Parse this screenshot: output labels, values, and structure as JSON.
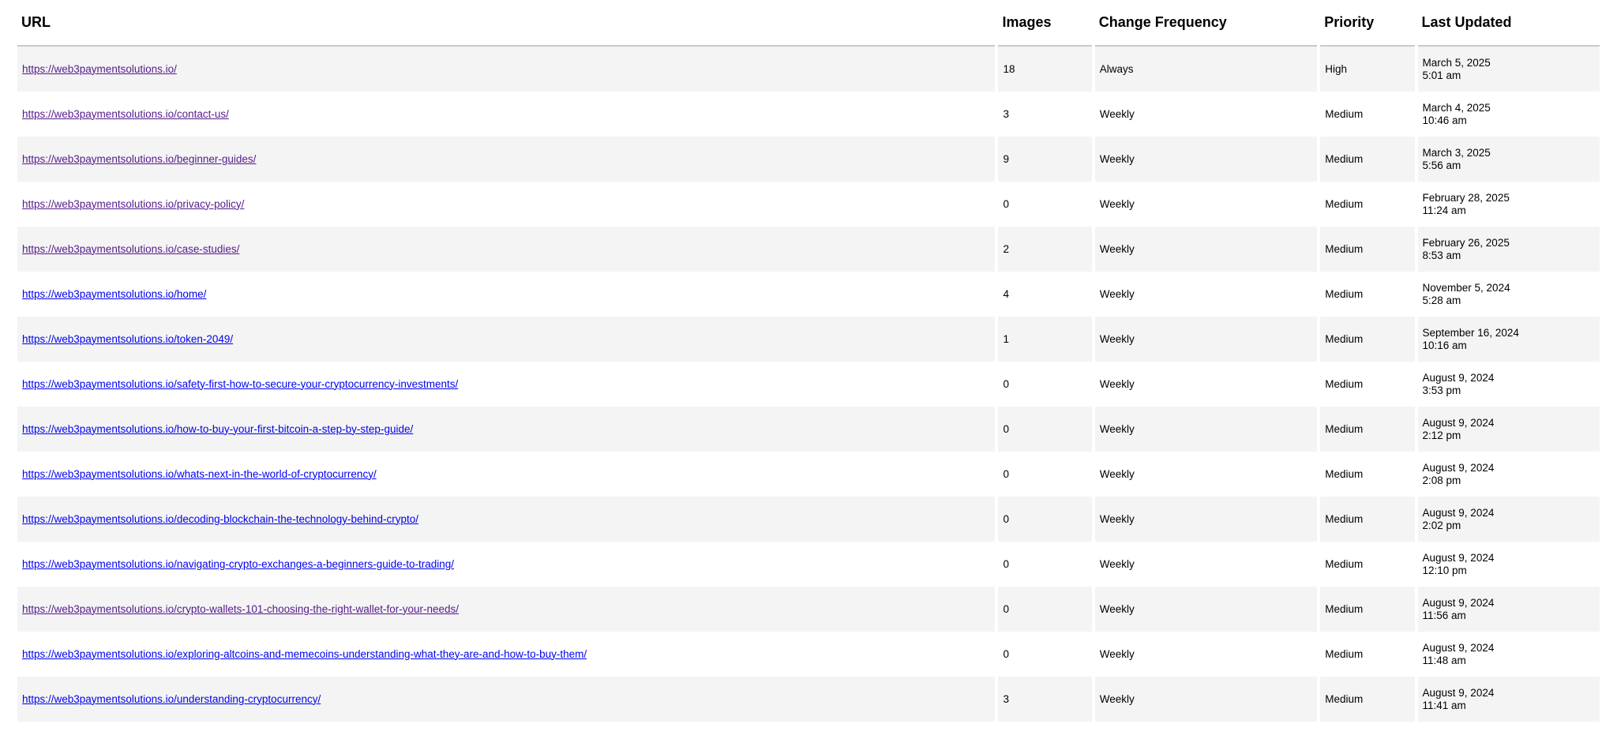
{
  "table": {
    "headers": {
      "url": "URL",
      "images": "Images",
      "frequency": "Change Frequency",
      "priority": "Priority",
      "updated": "Last Updated"
    },
    "rows": [
      {
        "url": "https://web3paymentsolutions.io/",
        "visited": true,
        "images": "18",
        "frequency": "Always",
        "priority": "High",
        "date": "March 5, 2025",
        "time": "5:01 am"
      },
      {
        "url": "https://web3paymentsolutions.io/contact-us/",
        "visited": true,
        "images": "3",
        "frequency": "Weekly",
        "priority": "Medium",
        "date": "March 4, 2025",
        "time": "10:46 am"
      },
      {
        "url": "https://web3paymentsolutions.io/beginner-guides/",
        "visited": true,
        "images": "9",
        "frequency": "Weekly",
        "priority": "Medium",
        "date": "March 3, 2025",
        "time": "5:56 am"
      },
      {
        "url": "https://web3paymentsolutions.io/privacy-policy/",
        "visited": true,
        "images": "0",
        "frequency": "Weekly",
        "priority": "Medium",
        "date": "February 28, 2025",
        "time": "11:24 am"
      },
      {
        "url": "https://web3paymentsolutions.io/case-studies/",
        "visited": true,
        "images": "2",
        "frequency": "Weekly",
        "priority": "Medium",
        "date": "February 26, 2025",
        "time": "8:53 am"
      },
      {
        "url": "https://web3paymentsolutions.io/home/",
        "visited": false,
        "images": "4",
        "frequency": "Weekly",
        "priority": "Medium",
        "date": "November 5, 2024",
        "time": "5:28 am"
      },
      {
        "url": "https://web3paymentsolutions.io/token-2049/",
        "visited": false,
        "images": "1",
        "frequency": "Weekly",
        "priority": "Medium",
        "date": "September 16, 2024",
        "time": "10:16 am"
      },
      {
        "url": "https://web3paymentsolutions.io/safety-first-how-to-secure-your-cryptocurrency-investments/",
        "visited": false,
        "images": "0",
        "frequency": "Weekly",
        "priority": "Medium",
        "date": "August 9, 2024",
        "time": "3:53 pm"
      },
      {
        "url": "https://web3paymentsolutions.io/how-to-buy-your-first-bitcoin-a-step-by-step-guide/",
        "visited": false,
        "images": "0",
        "frequency": "Weekly",
        "priority": "Medium",
        "date": "August 9, 2024",
        "time": "2:12 pm"
      },
      {
        "url": "https://web3paymentsolutions.io/whats-next-in-the-world-of-cryptocurrency/",
        "visited": false,
        "images": "0",
        "frequency": "Weekly",
        "priority": "Medium",
        "date": "August 9, 2024",
        "time": "2:08 pm"
      },
      {
        "url": "https://web3paymentsolutions.io/decoding-blockchain-the-technology-behind-crypto/",
        "visited": false,
        "images": "0",
        "frequency": "Weekly",
        "priority": "Medium",
        "date": "August 9, 2024",
        "time": "2:02 pm"
      },
      {
        "url": "https://web3paymentsolutions.io/navigating-crypto-exchanges-a-beginners-guide-to-trading/",
        "visited": false,
        "images": "0",
        "frequency": "Weekly",
        "priority": "Medium",
        "date": "August 9, 2024",
        "time": "12:10 pm"
      },
      {
        "url": "https://web3paymentsolutions.io/crypto-wallets-101-choosing-the-right-wallet-for-your-needs/",
        "visited": true,
        "images": "0",
        "frequency": "Weekly",
        "priority": "Medium",
        "date": "August 9, 2024",
        "time": "11:56 am"
      },
      {
        "url": "https://web3paymentsolutions.io/exploring-altcoins-and-memecoins-understanding-what-they-are-and-how-to-buy-them/",
        "visited": false,
        "images": "0",
        "frequency": "Weekly",
        "priority": "Medium",
        "date": "August 9, 2024",
        "time": "11:48 am"
      },
      {
        "url": "https://web3paymentsolutions.io/understanding-cryptocurrency/",
        "visited": false,
        "images": "3",
        "frequency": "Weekly",
        "priority": "Medium",
        "date": "August 9, 2024",
        "time": "11:41 am"
      }
    ]
  },
  "colors": {
    "visited_link": "#551a8b",
    "unvisited_link": "#0000ee",
    "stripe": "#f4f4f4",
    "header_rule": "#c9c9c9"
  }
}
